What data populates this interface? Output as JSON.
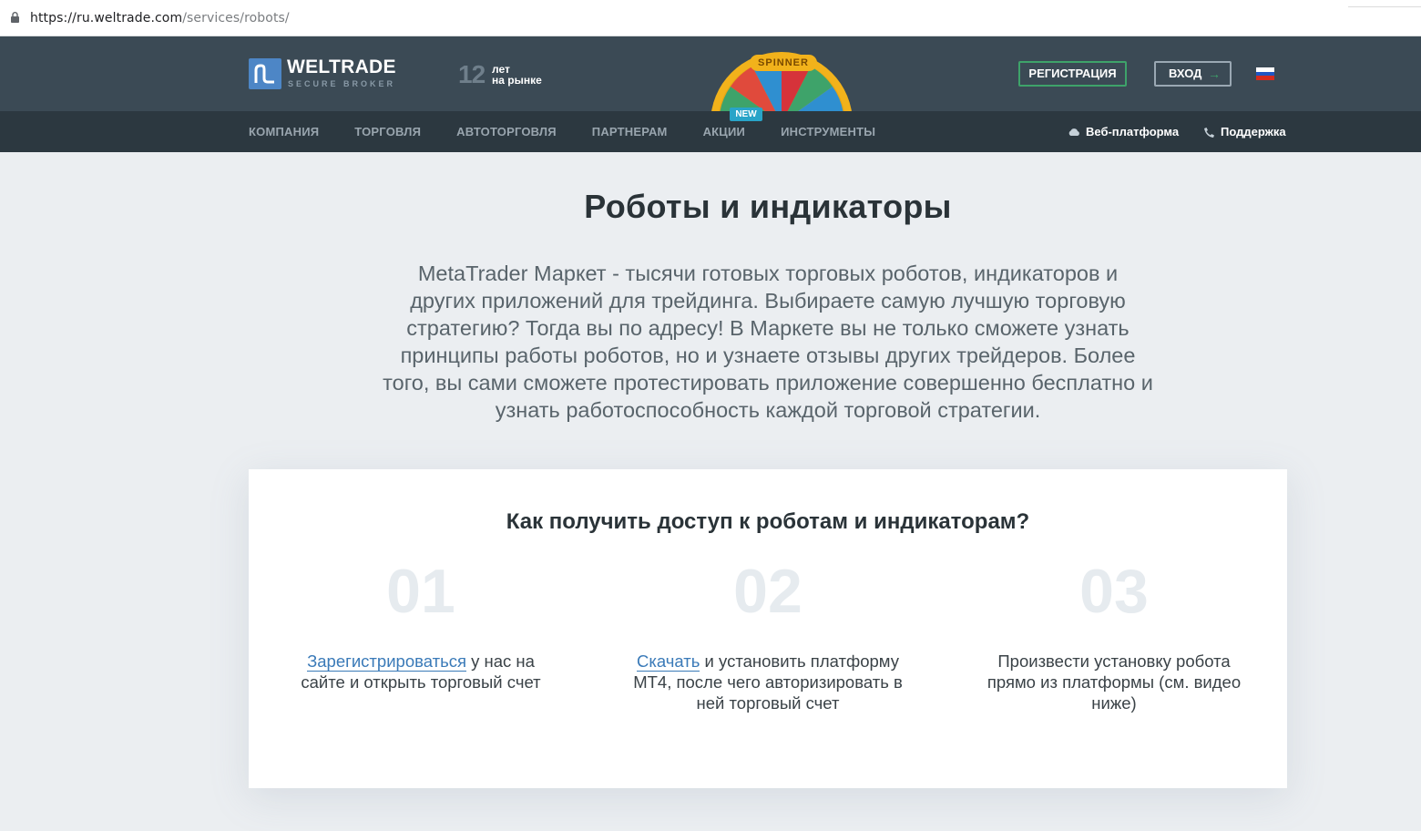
{
  "browser": {
    "url_host": "https://ru.weltrade.com",
    "url_path": "/services/robots/"
  },
  "header": {
    "logo": {
      "name": "WELTRADE",
      "tagline": "SECURE BROKER"
    },
    "years": {
      "number": "12",
      "line1": "лет",
      "line2": "на рынке"
    },
    "promo": {
      "label": "SPINNER",
      "badge": "NEW"
    },
    "register_label": "РЕГИСТРАЦИЯ",
    "login_label": "ВХОД",
    "language_flag": "ru"
  },
  "nav": {
    "items": [
      {
        "label": "КОМПАНИЯ"
      },
      {
        "label": "ТОРГОВЛЯ"
      },
      {
        "label": "АВТОТОРГОВЛЯ"
      },
      {
        "label": "ПАРТНЕРАМ"
      },
      {
        "label": "АКЦИИ"
      },
      {
        "label": "ИНСТРУМЕНТЫ"
      }
    ],
    "web_platform": "Веб-платформа",
    "support": "Поддержка"
  },
  "main": {
    "title": "Роботы и индикаторы",
    "lead": "MetaTrader Маркет - тысячи готовых торговых роботов, индикаторов и других приложений для трейдинга. Выбираете самую лучшую торговую стратегию? Тогда вы по адресу! В Маркете вы не только сможете узнать принципы работы роботов, но и узнаете отзывы других трейдеров. Более того, вы сами сможете протестировать приложение совершенно бесплатно и узнать работоспособность каждой торговой стратегии."
  },
  "access": {
    "title": "Как получить доступ к роботам и индикаторам?",
    "steps": [
      {
        "number": "01",
        "link": "Зарегистрироваться",
        "text": " у нас на сайте и открыть торговый счет"
      },
      {
        "number": "02",
        "link": "Скачать",
        "text": " и установить платформу МТ4, после чего авторизировать в ней торговый счет"
      },
      {
        "number": "03",
        "link": "",
        "text": "Произвести установку робота прямо из платформы (см. видео ниже)"
      }
    ]
  },
  "colors": {
    "header_bg": "#3b4a55",
    "nav_bg": "#2c3840",
    "accent_green": "#3ea36a",
    "link_blue": "#3a7ab8",
    "logo_blue": "#4d86c6"
  }
}
